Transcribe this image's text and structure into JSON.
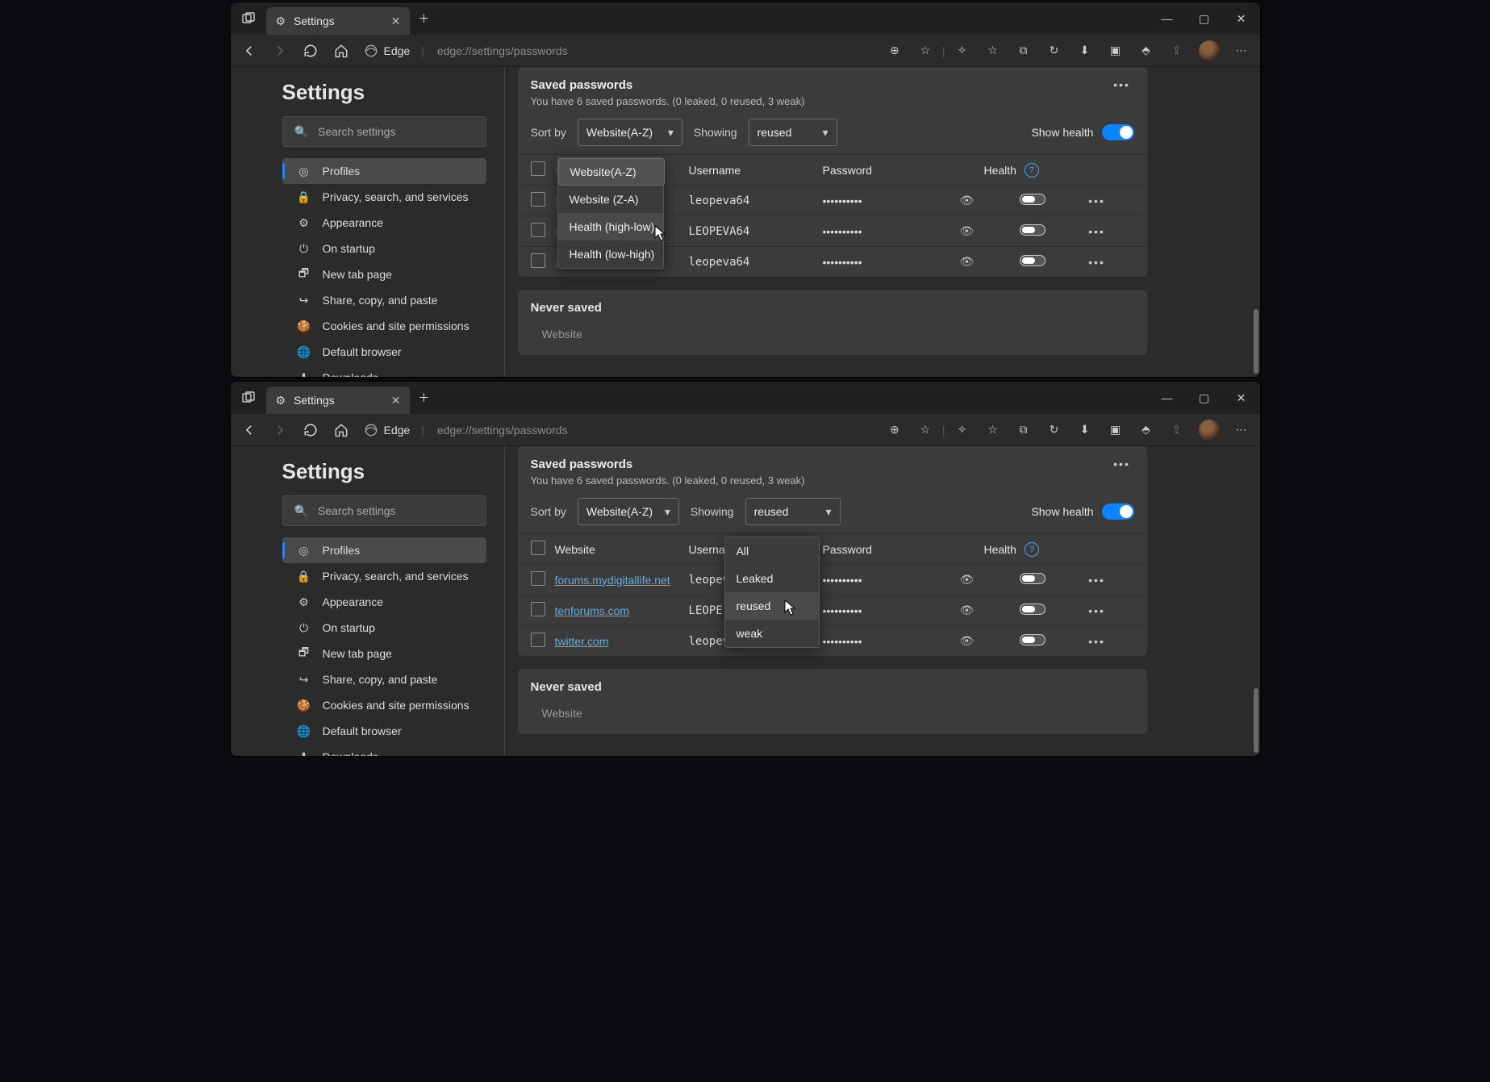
{
  "browser": {
    "tabTitle": "Settings",
    "appLabel": "Edge",
    "url": "edge://settings/passwords"
  },
  "sidebar": {
    "title": "Settings",
    "searchPlaceholder": "Search settings",
    "items": [
      {
        "icon": "◎",
        "label": "Profiles",
        "active": true
      },
      {
        "icon": "🔒",
        "label": "Privacy, search, and services"
      },
      {
        "icon": "⚙",
        "label": "Appearance"
      },
      {
        "icon": "⏻",
        "label": "On startup"
      },
      {
        "icon": "🗗",
        "label": "New tab page"
      },
      {
        "icon": "↪",
        "label": "Share, copy, and paste"
      },
      {
        "icon": "🍪",
        "label": "Cookies and site permissions"
      },
      {
        "icon": "🌐",
        "label": "Default browser"
      },
      {
        "icon": "⬇",
        "label": "Downloads"
      }
    ]
  },
  "card": {
    "title": "Saved passwords",
    "subtitle": "You have 6 saved passwords. (0 leaked, 0 reused, 3 weak)",
    "sortByLabel": "Sort by",
    "sortByValue": "Website(A-Z)",
    "sortOptions": [
      "Website(A-Z)",
      "Website (Z-A)",
      "Health (high-low)",
      "Health (low-high)"
    ],
    "showingLabel": "Showing",
    "showingValue": "reused",
    "showingOptions": [
      "All",
      "Leaked",
      "reused",
      "weak"
    ],
    "showHealthLabel": "Show health",
    "columns": {
      "website": "Website",
      "username": "Username",
      "password": "Password",
      "health": "Health"
    }
  },
  "rows": [
    {
      "site": "forums.mydigitallife.net",
      "user": "leopeva64",
      "pass": "••••••••••"
    },
    {
      "site": "tenforums.com",
      "user": "LEOPEVA64",
      "pass": "••••••••••"
    },
    {
      "site": "twitter.com",
      "user": "leopeva64",
      "pass": "••••••••••"
    }
  ],
  "rowsTopPartial": [
    {
      "user": "leopeva64",
      "pass": "••••••••••"
    },
    {
      "user": "LEOPEVA64",
      "pass": "••••••••••"
    },
    {
      "user": "leopeva64",
      "pass": "••••••••••"
    }
  ],
  "never": {
    "title": "Never saved",
    "website": "Website"
  }
}
